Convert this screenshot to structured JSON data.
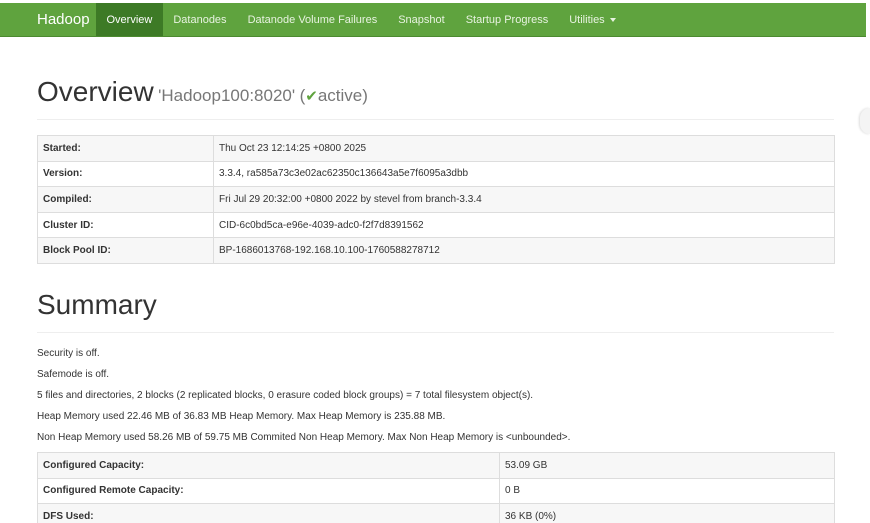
{
  "navbar": {
    "brand": "Hadoop",
    "items": [
      {
        "label": "Overview",
        "active": true
      },
      {
        "label": "Datanodes",
        "active": false
      },
      {
        "label": "Datanode Volume Failures",
        "active": false
      },
      {
        "label": "Snapshot",
        "active": false
      },
      {
        "label": "Startup Progress",
        "active": false
      },
      {
        "label": "Utilities",
        "active": false
      }
    ]
  },
  "overview": {
    "title": "Overview",
    "host": "'Hadoop100:8020'",
    "status_open": "(",
    "status_check": "✔",
    "status": "active",
    "status_close": ")",
    "rows": [
      {
        "key": "Started:",
        "value": "Thu Oct 23 12:14:25 +0800 2025"
      },
      {
        "key": "Version:",
        "value": "3.3.4, ra585a73c3e02ac62350c136643a5e7f6095a3dbb"
      },
      {
        "key": "Compiled:",
        "value": "Fri Jul 29 20:32:00 +0800 2022 by stevel from branch-3.3.4"
      },
      {
        "key": "Cluster ID:",
        "value": "CID-6c0bd5ca-e96e-4039-adc0-f2f7d8391562"
      },
      {
        "key": "Block Pool ID:",
        "value": "BP-1686013768-192.168.10.100-1760588278712"
      }
    ]
  },
  "summary": {
    "title": "Summary",
    "lines": [
      "Security is off.",
      "Safemode is off.",
      "5 files and directories, 2 blocks (2 replicated blocks, 0 erasure coded block groups) = 7 total filesystem object(s).",
      "Heap Memory used 22.46 MB of 36.83 MB Heap Memory. Max Heap Memory is 235.88 MB.",
      "Non Heap Memory used 58.26 MB of 59.75 MB Commited Non Heap Memory. Max Non Heap Memory is <unbounded>."
    ],
    "rows": [
      {
        "key": "Configured Capacity:",
        "value": "53.09 GB"
      },
      {
        "key": "Configured Remote Capacity:",
        "value": "0 B"
      },
      {
        "key": "DFS Used:",
        "value": "36 KB (0%)"
      }
    ]
  }
}
